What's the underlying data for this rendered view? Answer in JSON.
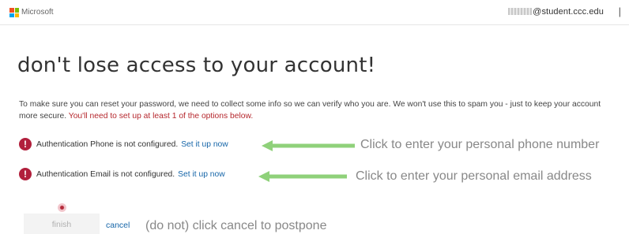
{
  "header": {
    "brand": "Microsoft",
    "user_email": "@student.ccc.edu",
    "separator": "|",
    "logo_colors": [
      "#f25022",
      "#7fba00",
      "#00a4ef",
      "#ffb900"
    ]
  },
  "main": {
    "title": "don't lose access to your account!",
    "description": "To make sure you can reset your password, we need to collect some info so we can verify who you are. We won't use this to spam you - just to keep your account more secure.",
    "description_warning": "You'll need to set up at least 1 of the options below.",
    "items": [
      {
        "status_icon": "!",
        "text": "Authentication Phone is not configured.",
        "link": "Set it up now"
      },
      {
        "status_icon": "!",
        "text": "Authentication Email is not configured.",
        "link": "Set it up now"
      }
    ]
  },
  "actions": {
    "finish_label": "finish",
    "cancel_label": "cancel"
  },
  "annotations": {
    "phone_note": "Click to enter your personal phone number",
    "email_note": "Click to enter your personal email address",
    "cancel_note": "(do not) click cancel to postpone"
  },
  "colors": {
    "alert": "#b11f3c",
    "link": "#1565a8",
    "warning_text": "#b5272d",
    "arrow": "#8fd17a"
  }
}
